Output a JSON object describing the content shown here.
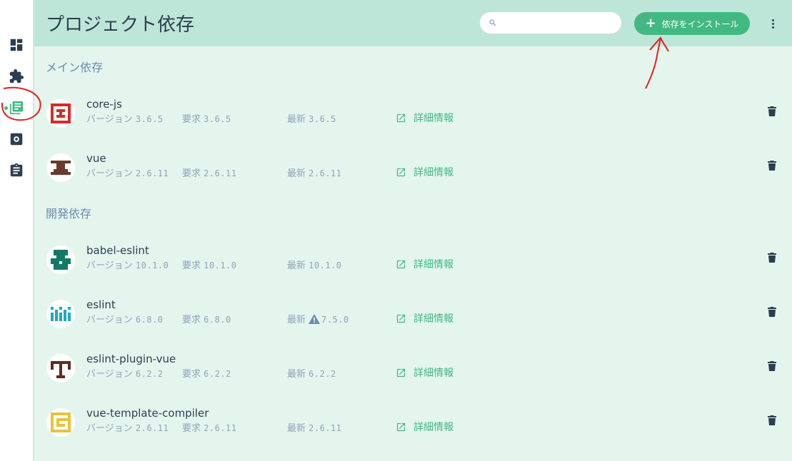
{
  "header": {
    "title": "プロジェクト依存",
    "search_placeholder": "",
    "install_label": "依存をインストール",
    "accent_color": "#42b983"
  },
  "sidebar": {
    "items": [
      {
        "icon": "dashboard-icon",
        "active": false
      },
      {
        "icon": "plugin-icon",
        "active": false
      },
      {
        "icon": "dependencies-icon",
        "active": true
      },
      {
        "icon": "config-icon",
        "active": false
      },
      {
        "icon": "tasks-icon",
        "active": false
      }
    ]
  },
  "sections": [
    {
      "title": "メイン依存",
      "deps": [
        {
          "name": "core-js",
          "version_label": "バージョン",
          "version": "3.6.5",
          "required_label": "要求",
          "required": "3.6.5",
          "latest_label": "最新",
          "latest": "3.6.5",
          "outdated": false,
          "details_label": "詳細情報"
        },
        {
          "name": "vue",
          "version_label": "バージョン",
          "version": "2.6.11",
          "required_label": "要求",
          "required": "2.6.11",
          "latest_label": "最新",
          "latest": "2.6.11",
          "outdated": false,
          "details_label": "詳細情報"
        }
      ]
    },
    {
      "title": "開発依存",
      "deps": [
        {
          "name": "babel-eslint",
          "version_label": "バージョン",
          "version": "10.1.0",
          "required_label": "要求",
          "required": "10.1.0",
          "latest_label": "最新",
          "latest": "10.1.0",
          "outdated": false,
          "details_label": "詳細情報"
        },
        {
          "name": "eslint",
          "version_label": "バージョン",
          "version": "6.8.0",
          "required_label": "要求",
          "required": "6.8.0",
          "latest_label": "最新",
          "latest": "7.5.0",
          "outdated": true,
          "details_label": "詳細情報"
        },
        {
          "name": "eslint-plugin-vue",
          "version_label": "バージョン",
          "version": "6.2.2",
          "required_label": "要求",
          "required": "6.2.2",
          "latest_label": "最新",
          "latest": "6.2.2",
          "outdated": false,
          "details_label": "詳細情報"
        },
        {
          "name": "vue-template-compiler",
          "version_label": "バージョン",
          "version": "2.6.11",
          "required_label": "要求",
          "required": "2.6.11",
          "latest_label": "最新",
          "latest": "2.6.11",
          "outdated": false,
          "details_label": "詳細情報"
        }
      ]
    }
  ]
}
